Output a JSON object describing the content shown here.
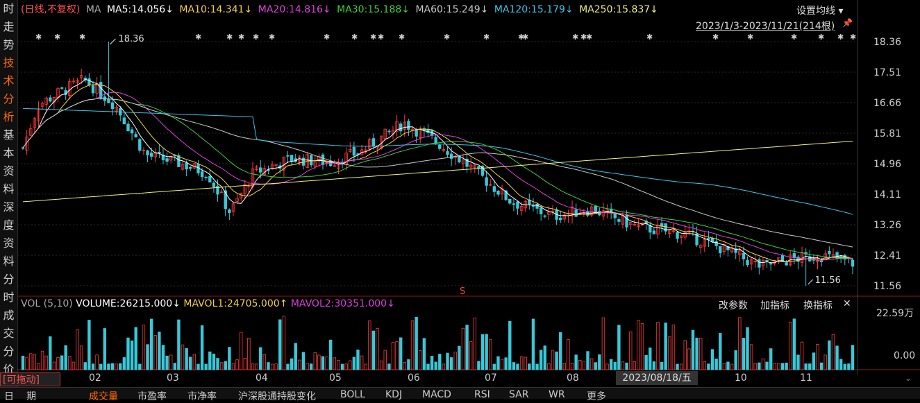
{
  "nav": {
    "items": [
      {
        "id": "time",
        "label": "时走势",
        "chars": [
          "时",
          "走",
          "势"
        ]
      },
      {
        "id": "tech",
        "label": "技术分析",
        "chars": [
          "技",
          "术",
          "分",
          "析"
        ]
      },
      {
        "id": "basic",
        "label": "基本资料",
        "chars": [
          "基",
          "本",
          "资",
          "料"
        ]
      },
      {
        "id": "depth",
        "label": "深度资料",
        "chars": [
          "深",
          "度",
          "资",
          "料"
        ]
      },
      {
        "id": "minute",
        "label": "分时成交",
        "chars": [
          "分",
          "时",
          "成",
          "交"
        ]
      },
      {
        "id": "fen",
        "label": "分价",
        "chars": [
          "分",
          "价"
        ]
      }
    ]
  },
  "top": {
    "mode": "(日线,不复权)",
    "ma_label": "MA",
    "ma": [
      {
        "text": "MA5:14.056↓",
        "color": "#ffffff"
      },
      {
        "text": "MA10:14.341↓",
        "color": "#f5d142"
      },
      {
        "text": "MA20:14.816↓",
        "color": "#e040e0"
      },
      {
        "text": "MA30:15.188↓",
        "color": "#3ecf3e"
      },
      {
        "text": "MA60:15.249↓",
        "color": "#c8c8c8"
      },
      {
        "text": "MA120:15.179↓",
        "color": "#36c8e8"
      },
      {
        "text": "MA250:15.837↓",
        "color": "#f0f07a"
      }
    ],
    "settings": "设置均线",
    "range": "2023/1/3-2023/11/21(214根)"
  },
  "price_axis": [
    "18.36",
    "17.51",
    "16.66",
    "15.81",
    "14.96",
    "14.11",
    "13.26",
    "12.41",
    "11.56"
  ],
  "annot": {
    "high": "18.36",
    "low": "11.56",
    "s": "S"
  },
  "vol": {
    "label": "VOL (5,10)",
    "volume": "VOLUME:26215.000↓",
    "mavol1": "MAVOL1:24705.000↑",
    "mavol2": "MAVOL2:30351.000↓",
    "btn_params": "改参数",
    "btn_add": "加指标",
    "btn_switch": "换指标",
    "axis_top": "22.59万",
    "axis_bottom": "0.00"
  },
  "months": [
    "02",
    "03",
    "04",
    "05",
    "06",
    "07",
    "08",
    "10",
    "11"
  ],
  "date_tip": "2023/08/18/五",
  "drag_badge": "[可拖动]",
  "tabs": [
    "日",
    "期",
    "成交量",
    "市盈率",
    "市净率",
    "沪深股通持股变化",
    "BOLL",
    "KDJ",
    "MACD",
    "RSI",
    "SAR",
    "WR",
    "更多"
  ],
  "chart_data": {
    "type": "candlestick",
    "y_range": [
      11.56,
      18.36
    ],
    "high": 18.36,
    "low": 11.56,
    "bars": 214
  }
}
